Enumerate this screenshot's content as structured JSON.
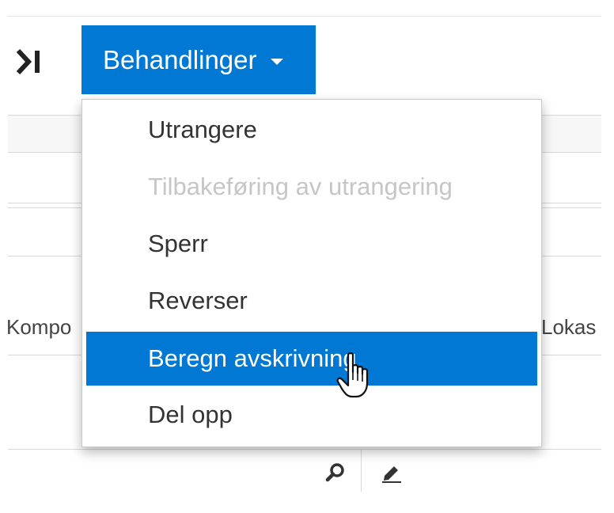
{
  "toolbar": {
    "collapse_icon": "collapse-pane-icon",
    "menu_button_label": "Behandlinger"
  },
  "dropdown": {
    "items": [
      {
        "label": "Utrangere",
        "state": "enabled"
      },
      {
        "label": "Tilbakeføring av utrangering",
        "state": "disabled"
      },
      {
        "label": "Sperr",
        "state": "enabled"
      },
      {
        "label": "Reverser",
        "state": "enabled"
      },
      {
        "label": "Beregn avskrivning",
        "state": "highlighted"
      },
      {
        "label": "Del opp",
        "state": "enabled"
      }
    ]
  },
  "grid": {
    "left_header": "Kompo",
    "right_header": "Lokas",
    "row_icons": [
      "search-icon",
      "edit-pencil-icon"
    ]
  },
  "colors": {
    "accent": "#0078d4",
    "disabled_text": "#c6c6c6",
    "text": "#333333"
  }
}
